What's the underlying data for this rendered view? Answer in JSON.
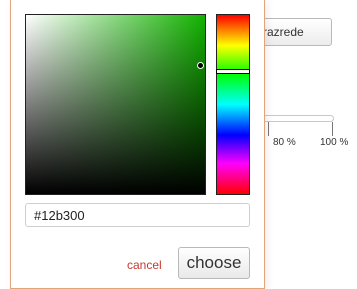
{
  "background": {
    "button_label": "razrede",
    "slider_ticks": [
      "80 %",
      "100 %"
    ]
  },
  "color_picker": {
    "current_hex": "#12b300",
    "hue_color": "#12b300",
    "cancel_label": "cancel",
    "choose_label": "choose",
    "icons": {
      "sat_handle": "saturation-handle",
      "hue_handle": "hue-handle"
    },
    "colors": {
      "cancel": "#c53a2f",
      "border": "#e0a67a"
    }
  }
}
